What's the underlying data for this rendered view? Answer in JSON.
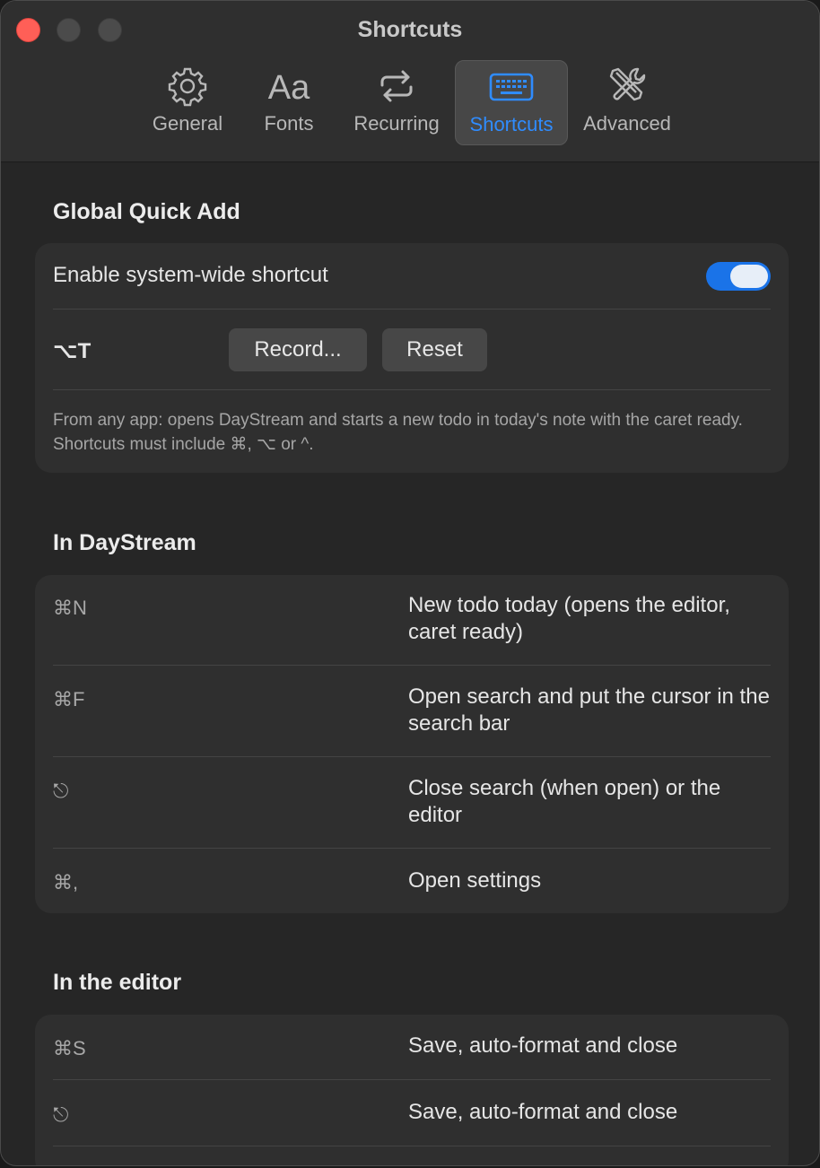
{
  "window": {
    "title": "Shortcuts"
  },
  "tabs": [
    {
      "label": "General",
      "icon": "gear-icon"
    },
    {
      "label": "Fonts",
      "icon": "fonts-icon",
      "glyph": "Aa"
    },
    {
      "label": "Recurring",
      "icon": "repeat-icon"
    },
    {
      "label": "Shortcuts",
      "icon": "keyboard-icon",
      "active": true
    },
    {
      "label": "Advanced",
      "icon": "tools-icon"
    }
  ],
  "global_quick_add": {
    "title": "Global Quick Add",
    "enable_label": "Enable system-wide shortcut",
    "enabled": true,
    "current_shortcut": "⌥T",
    "record_label": "Record...",
    "reset_label": "Reset",
    "note": "From any app: opens DayStream and starts a new todo in today's note with the caret ready. Shortcuts must include ⌘, ⌥ or ^."
  },
  "in_daystream": {
    "title": "In DayStream",
    "rows": [
      {
        "key": "⌘N",
        "desc": "New todo today (opens the editor, caret ready)"
      },
      {
        "key": "⌘F",
        "desc": "Open search and put the cursor in the search bar"
      },
      {
        "key": "⎋",
        "key_icon": "escape-icon",
        "desc": "Close search (when open) or the editor"
      },
      {
        "key": "⌘,",
        "desc": "Open settings"
      }
    ]
  },
  "in_editor": {
    "title": "In the editor",
    "rows": [
      {
        "key": "⌘S",
        "desc": "Save, auto-format and close"
      },
      {
        "key": "⎋",
        "key_icon": "escape-icon",
        "desc": "Save, auto-format and close"
      }
    ]
  },
  "colors": {
    "accent": "#2f8cff",
    "toggle_on": "#1a73e8",
    "close_button": "#ff5f57"
  }
}
